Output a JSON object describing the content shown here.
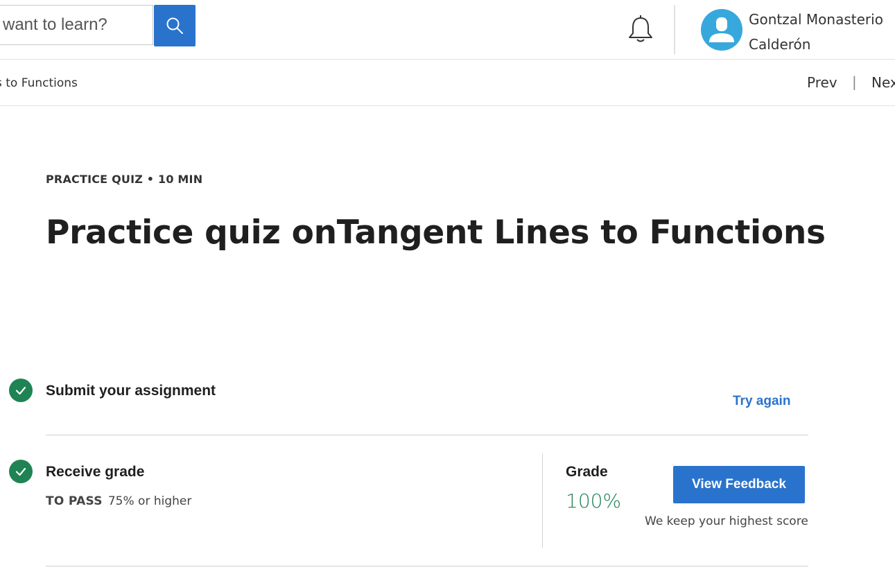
{
  "header": {
    "search_placeholder": "want to learn?",
    "search_button_icon": "search-icon",
    "notifications_icon": "bell-icon",
    "user_name": "Gontzal Monasterio Calderón",
    "avatar_color": "#37a8dc"
  },
  "subnav": {
    "breadcrumb": "s to Functions",
    "prev_label": "Prev",
    "separator": "|",
    "next_label": "Nex"
  },
  "quiz": {
    "eyebrow": "PRACTICE QUIZ • 10 MIN",
    "title": "Practice quiz onTangent Lines to Functions"
  },
  "steps": [
    {
      "title": "Submit your assignment",
      "action_label": "Try again",
      "status_icon": "check-icon"
    },
    {
      "title": "Receive grade",
      "to_pass_label": "TO PASS",
      "to_pass_value": "75% or higher",
      "status_icon": "check-icon"
    }
  ],
  "grade": {
    "label": "Grade",
    "value": "100%",
    "button_label": "View Feedback",
    "note": "We keep your highest score"
  },
  "colors": {
    "primary": "#2a73cc",
    "success": "#1f8354"
  }
}
